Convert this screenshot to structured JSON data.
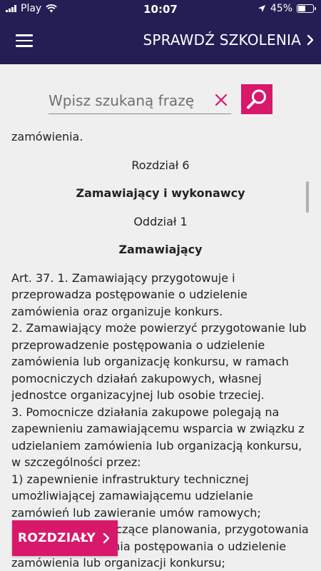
{
  "status_bar": {
    "carrier": "Play",
    "time": "10:07",
    "battery": "45%",
    "battery_level": 0.45
  },
  "nav": {
    "title": "SPRAWDŹ SZKOLENIA"
  },
  "search": {
    "placeholder": "Wpisz szukaną frazę",
    "value": ""
  },
  "document": {
    "cut_top_line": "zamówienia.",
    "chapter": "Rozdział 6",
    "chapter_title": "Zamawiający i wykonawcy",
    "section": "Oddział 1",
    "section_title": "Zamawiający",
    "paragraphs": [
      "Art. 37. 1. Zamawiający przygotowuje i przeprowadza postępowanie o udzielenie zamówienia oraz organizuje konkurs.",
      "2.    Zamawiający może powierzyć przygotowanie lub przeprowadzenie postępowania o udzielenie zamówienia lub organizację konkursu, w ramach pomocniczych działań zakupowych, własnej jednostce organizacyjnej lub osobie trzeciej.",
      "3.    Pomocnicze działania zakupowe polegają na zapewnieniu zamawiającemu wsparcia w związku z udzielaniem zamówienia lub organizacją konkursu, w szczególności przez:",
      "1)    zapewnienie infrastruktury technicznej umożliwiającej zamawiającemu udzielanie zamówień lub zawieranie umów ramowych;",
      "2)    doradztwo dotyczące planowania, przygotowania lub przeprowadzenia postępowania o udzielenie zamówienia lub organizacji konkursu;"
    ]
  },
  "chapters_button": {
    "label": "ROZDZIAŁY"
  },
  "colors": {
    "navbar": "#231f54",
    "accent": "#d8186b",
    "background": "#efefef"
  }
}
